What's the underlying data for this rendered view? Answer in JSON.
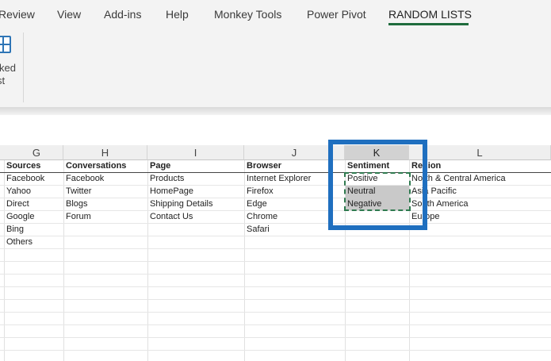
{
  "ribbon": {
    "tabs": [
      {
        "label": "Review"
      },
      {
        "label": "View"
      },
      {
        "label": "Add-ins"
      },
      {
        "label": "Help"
      },
      {
        "label": "Monkey Tools"
      },
      {
        "label": "Power Pivot"
      },
      {
        "label": "RANDOM LISTS",
        "active": true
      }
    ],
    "partial_button": {
      "line1": "ked",
      "line2": "st",
      "icon": "grid-table-icon"
    }
  },
  "sheet": {
    "column_headers": [
      "G",
      "H",
      "I",
      "J",
      "K",
      "L"
    ],
    "selected_column": "K",
    "columns": {
      "G": {
        "header": "Sources",
        "values": [
          "Facebook",
          "Yahoo",
          "Direct",
          "Google",
          "Bing",
          "Others"
        ]
      },
      "H": {
        "header": "Conversations",
        "values": [
          "Facebook",
          "Twitter",
          "Blogs",
          "Forum"
        ]
      },
      "I": {
        "header": "Page",
        "values": [
          "Products",
          "HomePage",
          "Shipping Details",
          "Contact Us"
        ]
      },
      "J": {
        "header": "Browser",
        "values": [
          "Internet Explorer",
          "Firefox",
          "Edge",
          "Chrome",
          "Safari"
        ]
      },
      "K": {
        "header": "Sentiment",
        "values": [
          "Positive",
          "Neutral",
          "Negative"
        ]
      },
      "L": {
        "header": "Region",
        "values": [
          "North & Central America",
          "Asia Pacific",
          "South America",
          "Europe"
        ]
      }
    }
  },
  "colors": {
    "accent_tab": "#1e6b3c",
    "annotation_box": "#1f6fbf",
    "copy_marquee": "#2f7a4f",
    "selection_fill": "#c9c9c9"
  }
}
